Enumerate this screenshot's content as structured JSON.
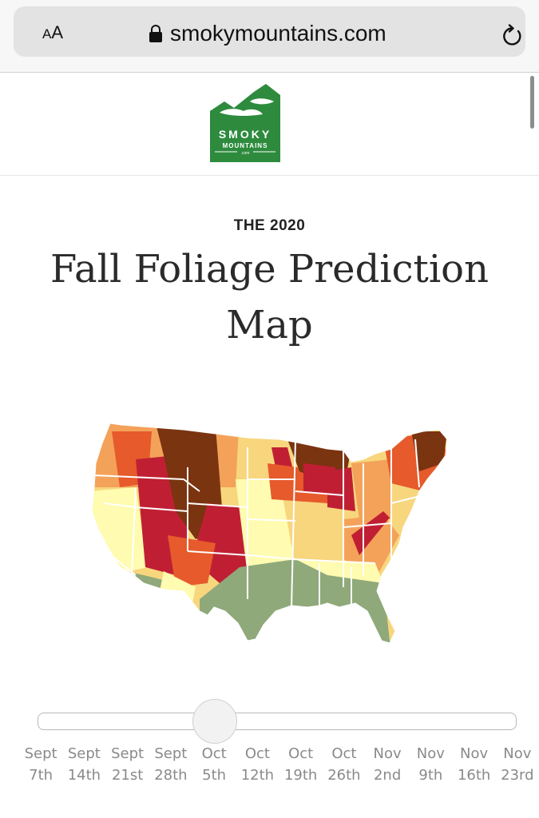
{
  "browser": {
    "text_size_label_small": "A",
    "text_size_label_large": "A",
    "url": "smokymountains.com",
    "icons": [
      "text-size-icon",
      "lock-icon",
      "reload-icon"
    ]
  },
  "header": {
    "logo_line1": "SMOKY",
    "logo_line2": "MOUNTAINS",
    "logo_line3": ".com",
    "logo_color": "#2e8b3e"
  },
  "hero": {
    "eyebrow": "THE 2020",
    "title": "Fall Foliage Prediction Map"
  },
  "map": {
    "legend_colors": {
      "no_change": "#8fa97a",
      "minimal": "#fffbb0",
      "patchy": "#f7d67e",
      "partial": "#f4a25a",
      "near_peak": "#e65a2c",
      "peak": "#c01f33",
      "past_peak": "#7a3410"
    }
  },
  "slider": {
    "selected_index": 4,
    "selected_label": "Oct 5th",
    "ticks": [
      {
        "month": "Sept",
        "day": "7th"
      },
      {
        "month": "Sept",
        "day": "14th"
      },
      {
        "month": "Sept",
        "day": "21st"
      },
      {
        "month": "Sept",
        "day": "28th"
      },
      {
        "month": "Oct",
        "day": "5th"
      },
      {
        "month": "Oct",
        "day": "12th"
      },
      {
        "month": "Oct",
        "day": "19th"
      },
      {
        "month": "Oct",
        "day": "26th"
      },
      {
        "month": "Nov",
        "day": "2nd"
      },
      {
        "month": "Nov",
        "day": "9th"
      },
      {
        "month": "Nov",
        "day": "16th"
      },
      {
        "month": "Nov",
        "day": "23rd"
      }
    ]
  }
}
